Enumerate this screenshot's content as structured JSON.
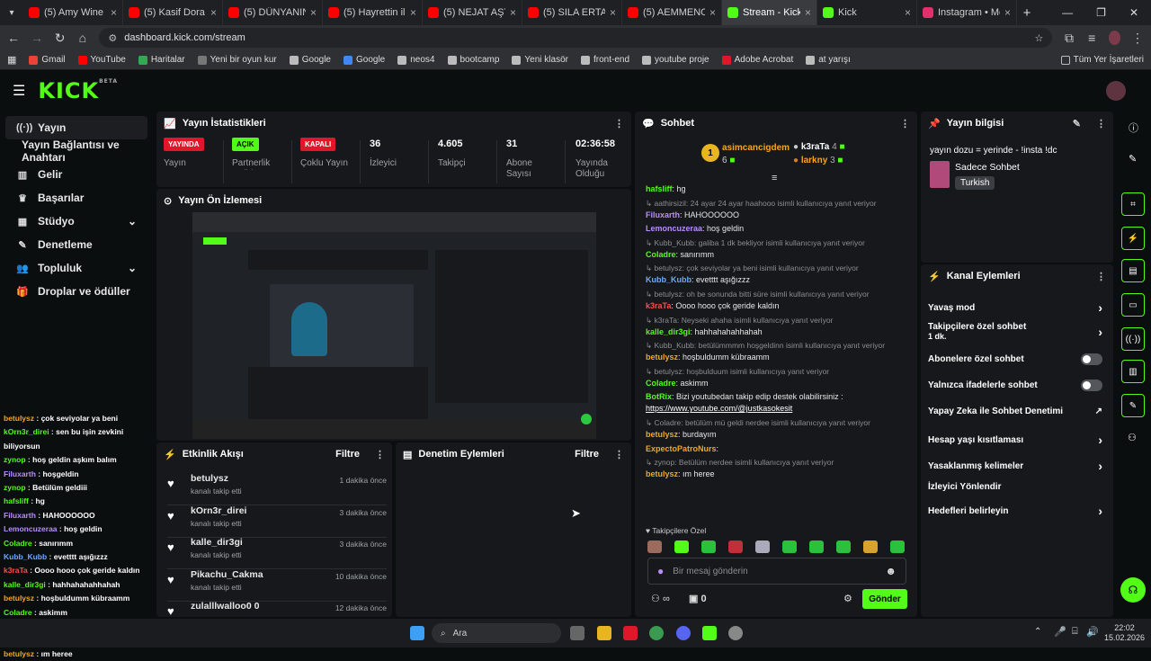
{
  "browser": {
    "tabs": [
      {
        "label": "(5) Amy Wine",
        "color": "#ff0000"
      },
      {
        "label": "(5) Kasif Dora ten",
        "color": "#ff0000"
      },
      {
        "label": "(5) DÜNYANIN EN",
        "color": "#ff0000"
      },
      {
        "label": "(5) Hayrettin ile K",
        "color": "#ff0000"
      },
      {
        "label": "(5) NEJAT AŞTAR",
        "color": "#ff0000"
      },
      {
        "label": "(5) SILA ERTAŞ",
        "color": "#ff0000"
      },
      {
        "label": "(5) AEMMENOGL",
        "color": "#ff0000"
      },
      {
        "label": "Stream - Kick Da",
        "color": "#53fc18"
      },
      {
        "label": "Kick",
        "color": "#53fc18"
      },
      {
        "label": "Instagram • Mesa",
        "color": "#e1306c"
      }
    ],
    "new_tab": "+",
    "url": "dashboard.kick.com/stream",
    "bookmarks": [
      "Gmail",
      "YouTube",
      "Haritalar",
      "Yeni bir oyun kur",
      "Google",
      "Google",
      "neos4",
      "bootcamp",
      "Yeni klasör",
      "front-end",
      "youtube proje",
      "Adobe Acrobat",
      "at yarışı"
    ],
    "all_bookmarks": "Tüm Yer İşaretleri"
  },
  "kick": {
    "logo": "KICK",
    "beta": "BETA"
  },
  "sidebar": {
    "items": [
      {
        "label": "Yayın",
        "icon": "broadcast-icon"
      },
      {
        "label": "Yayın Bağlantısı ve Anahtarı",
        "icon": ""
      },
      {
        "label": "Gelir",
        "icon": "revenue-icon"
      },
      {
        "label": "Başarılar",
        "icon": "trophy-icon"
      },
      {
        "label": "Stüdyo",
        "icon": "studio-icon"
      },
      {
        "label": "Denetleme",
        "icon": "wrench-icon"
      },
      {
        "label": "Topluluk",
        "icon": "community-icon"
      },
      {
        "label": "Droplar ve ödüller",
        "icon": "gift-icon"
      }
    ]
  },
  "side_chat": [
    {
      "user": "betulysz",
      "text": "çok seviyolar ya beni",
      "color": "#f5a623"
    },
    {
      "user": "kOrn3r_direi",
      "text": "sen bu işin zevkini biliyorsun",
      "color": "#53fc18"
    },
    {
      "user": "zynop",
      "text": "hoş geldin aşkım balım",
      "color": "#53fc18"
    },
    {
      "user": "Filuxarth",
      "text": "hoşgeldin",
      "color": "#b98cff"
    },
    {
      "user": "zynop",
      "text": "Betülüm geldiii",
      "color": "#53fc18"
    },
    {
      "user": "hafsliff",
      "text": "hg",
      "color": "#53fc18"
    },
    {
      "user": "Filuxarth",
      "text": "HAHOOOOOO",
      "color": "#b98cff"
    },
    {
      "user": "Lemoncuzeraa",
      "text": "hoş geldin",
      "color": "#b98cff"
    },
    {
      "user": "Coladre",
      "text": "sanırımm",
      "color": "#53fc18"
    },
    {
      "user": "Kubb_Kubb",
      "text": "evetttt aşığızzz",
      "color": "#6fa8ff"
    },
    {
      "user": "k3raTa",
      "text": "Oooo hooo çok geride kaldın",
      "color": "#ff4d4d"
    },
    {
      "user": "kalle_dir3gi",
      "text": "hahhahahahhahah",
      "color": "#53fc18"
    },
    {
      "user": "betulysz",
      "text": "hoşbuldumm kübraamm",
      "color": "#f5a623"
    },
    {
      "user": "Coladre",
      "text": "askimm",
      "color": "#53fc18"
    },
    {
      "user": "betulysz",
      "text": "burdayım",
      "color": "#f5a623"
    },
    {
      "user": "ExpectoPatroNurs",
      "text": "",
      "color": "#f5a623"
    },
    {
      "user": "betulysz",
      "text": "ım heree",
      "color": "#f5a623"
    }
  ],
  "stats": {
    "title": "Yayın İstatistikleri",
    "items": [
      {
        "value": "YAYINDA",
        "label": "Yayın",
        "badge_color": "#e0172b"
      },
      {
        "value": "AÇIK",
        "label": "Partnerlik Geliri",
        "badge_color": "#53fc18"
      },
      {
        "value": "KAPALI",
        "label": "Çoklu Yayın",
        "badge_color": "#e0172b"
      },
      {
        "value": "36",
        "label": "İzleyici"
      },
      {
        "value": "4.605",
        "label": "Takipçi"
      },
      {
        "value": "31",
        "label": "Abone Sayısı"
      },
      {
        "value": "02:36:58",
        "label": "Yayında Olduğu"
      }
    ]
  },
  "preview": {
    "title": "Yayın Ön İzlemesi"
  },
  "activity": {
    "title": "Etkinlik Akışı",
    "filter": "Filtre",
    "items": [
      {
        "user": "betulysz",
        "desc": "kanalı takip etti",
        "time": "1 dakika önce"
      },
      {
        "user": "kOrn3r_direi",
        "desc": "kanalı takip etti",
        "time": "3 dakika önce"
      },
      {
        "user": "kalle_dir3gi",
        "desc": "kanalı takip etti",
        "time": "3 dakika önce"
      },
      {
        "user": "Pikachu_Cakma",
        "desc": "kanalı takip etti",
        "time": "10 dakika önce"
      },
      {
        "user": "zulalllwalloo0 0",
        "desc": "",
        "time": "12 dakika önce"
      }
    ]
  },
  "moderation": {
    "title": "Denetim Eylemleri",
    "filter": "Filtre"
  },
  "chat": {
    "title": "Sohbet",
    "top_gifter": {
      "name": "asimcancigdem",
      "rank": "1",
      "count": "6"
    },
    "others": [
      {
        "name": "k3raTa",
        "count": "4"
      },
      {
        "name": "larkny",
        "count": "3"
      }
    ],
    "messages": [
      {
        "reply": "",
        "user": "hafsliff",
        "text": "hg",
        "color": "#53fc18"
      },
      {
        "reply": "aathirsizil: 24 ayar 24 ayar haahooo isimli kullanıcıya yanıt veriyor",
        "user": "Filuxarth",
        "text": "HAHOOOOOO",
        "color": "#b98cff"
      },
      {
        "reply": "",
        "user": "Lemoncuzeraa",
        "text": "hoş geldin",
        "color": "#b98cff"
      },
      {
        "reply": "Kubb_Kubb: galiba 1 dk bekliyor isimli kullanıcıya yanıt veriyor",
        "user": "Coladre",
        "text": "sanırımm",
        "color": "#53fc18"
      },
      {
        "reply": "betulysz: çok seviyolar ya beni isimli kullanıcıya yanıt veriyor",
        "user": "Kubb_Kubb",
        "text": "evetttt aşığızzz",
        "color": "#6fa8ff"
      },
      {
        "reply": "betulysz: oh be sonunda bitti süre isimli kullanıcıya yanıt veriyor",
        "user": "k3raTa",
        "text": "Oooo hooo çok geride kaldın",
        "color": "#ff4d4d"
      },
      {
        "reply": "k3raTa: Neyseki ahaha isimli kullanıcıya yanıt veriyor",
        "user": "kalle_dir3gi",
        "text": "hahhahahahhahah",
        "color": "#53fc18"
      },
      {
        "reply": "Kubb_Kubb: betülümmmm hoşgeldinn isimli kullanıcıya yanıt veriyor",
        "user": "betulysz",
        "text": "hoşbuldumm kübraamm",
        "color": "#f5a623"
      },
      {
        "reply": "betulysz: hoşbulduum isimli kullanıcıya yanıt veriyor",
        "user": "Coladre",
        "text": "askimm",
        "color": "#53fc18"
      },
      {
        "reply": "",
        "user": "BotRix",
        "text": "Bizi youtubedan takip edip destek olabilirsiniz :",
        "color": "#53fc18",
        "link": "https://www.youtube.com/@justkasokesit"
      },
      {
        "reply": "Coladre: betülüm mü geldi nerdee isimli kullanıcıya yanıt veriyor",
        "user": "betulysz",
        "text": "burdayım",
        "color": "#f5a623"
      },
      {
        "reply": "",
        "user": "ExpectoPatroNurs",
        "text": "",
        "color": "#f5a623"
      },
      {
        "reply": "zynop: Betülüm nerdee isimli kullanıcıya yanıt veriyor",
        "user": "betulysz",
        "text": "ım heree",
        "color": "#f5a623"
      }
    ],
    "followers_only": "Takipçilere Özel",
    "input_placeholder": "Bir mesaj gönderin",
    "points": "0",
    "send": "Gönder",
    "infinity": "∞"
  },
  "stream_info": {
    "title": "Yayın bilgisi",
    "stream_title": "yayın dozu = yerinde - !insta !dc",
    "category": "Sadece Sohbet",
    "language": "Turkish"
  },
  "channel_actions": {
    "title": "Kanal Eylemleri",
    "items": [
      {
        "label": "Yavaş mod",
        "type": "arrow"
      },
      {
        "label": "Takipçilere özel sohbet",
        "sub": "1 dk.",
        "type": "arrow"
      },
      {
        "label": "Abonelere özel sohbet",
        "type": "toggle"
      },
      {
        "label": "Yalnızca ifadelerle sohbet",
        "type": "toggle"
      },
      {
        "label": "Yapay Zeka ile Sohbet Denetimi",
        "type": "ext"
      },
      {
        "label": "Hesap yaşı kısıtlaması",
        "type": "arrow"
      },
      {
        "label": "Yasaklanmış kelimeler",
        "type": "arrow"
      },
      {
        "label": "İzleyici Yönlendir",
        "type": "none"
      },
      {
        "label": "Hedefleri belirleyin",
        "type": "arrow"
      }
    ]
  },
  "taskbar": {
    "search": "Ara",
    "time": "22:02",
    "date": "15.02.2026"
  },
  "colors": {
    "accent": "#53fc18",
    "bg": "#0b0e0f",
    "panel": "#16181b",
    "live": "#e0172b"
  }
}
